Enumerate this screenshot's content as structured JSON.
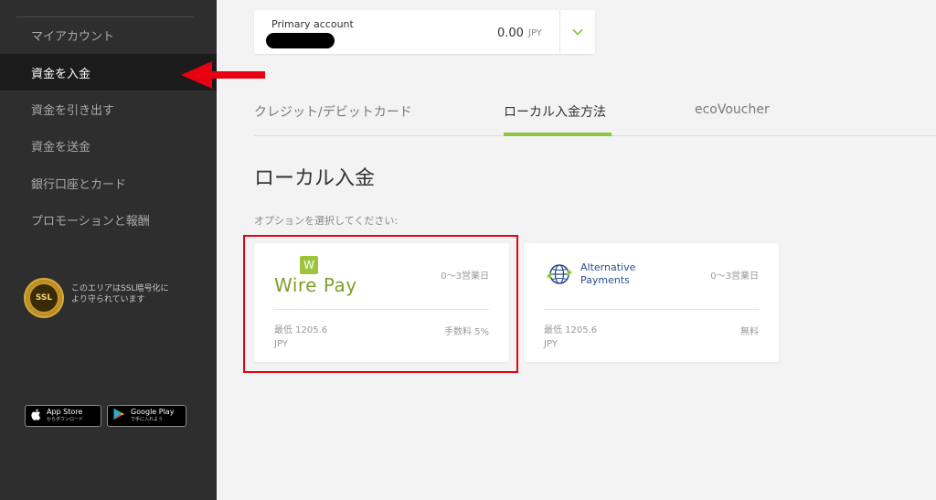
{
  "sidebar": {
    "items": [
      {
        "label": "マイアカウント",
        "active": false
      },
      {
        "label": "資金を入金",
        "active": true
      },
      {
        "label": "資金を引き出す",
        "active": false
      },
      {
        "label": "資金を送金",
        "active": false
      },
      {
        "label": "銀行口座とカード",
        "active": false
      },
      {
        "label": "プロモーションと報酬",
        "active": false
      }
    ],
    "ssl_badge_text": "SSL",
    "ssl_text": "このエリアはSSL暗号化により守られています",
    "app_store": {
      "title": "App Store",
      "subtitle": "からダウンロード"
    },
    "google_play": {
      "title": "Google Play",
      "subtitle": "で手に入れよう"
    }
  },
  "account": {
    "label": "Primary account",
    "amount": "0.00",
    "currency": "JPY"
  },
  "tabs": [
    {
      "label": "クレジット/デビットカード",
      "active": false
    },
    {
      "label": "ローカル入金方法",
      "active": true
    },
    {
      "label": "ecoVoucher",
      "active": false
    }
  ],
  "section": {
    "title": "ローカル入金",
    "subtitle": "オプションを選択してください:"
  },
  "options": [
    {
      "name": "Wire Pay",
      "logo_letter": "W",
      "days": "0〜3営業日",
      "min_line1": "最低 1205.6",
      "min_line2": "JPY",
      "fee": "手数料 5%",
      "highlighted": true
    },
    {
      "name_line1": "Alternative",
      "name_line2": "Payments",
      "days": "0〜3営業日",
      "min_line1": "最低 1205.6",
      "min_line2": "JPY",
      "fee": "無料",
      "highlighted": false
    }
  ],
  "colors": {
    "sidebar_bg": "#2e2e2e",
    "sidebar_active_bg": "#1b1b1b",
    "accent_green": "#8cc63f",
    "annotation_red": "#e60012"
  }
}
